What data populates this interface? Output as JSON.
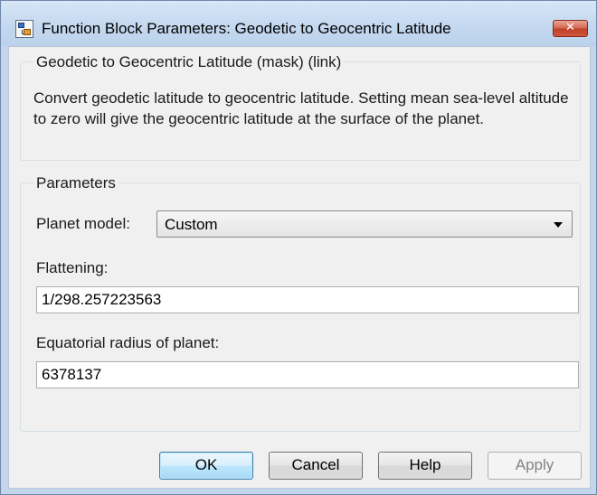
{
  "window": {
    "title": "Function Block Parameters: Geodetic to Geocentric Latitude",
    "close_label": "✕"
  },
  "description_group": {
    "legend": "Geodetic to Geocentric Latitude (mask) (link)",
    "text": "Convert geodetic latitude to geocentric latitude. Setting mean sea-level altitude to zero will give the geocentric latitude at the surface of the planet."
  },
  "parameters_group": {
    "legend": "Parameters",
    "planet_model": {
      "label": "Planet model:",
      "value": "Custom"
    },
    "flattening": {
      "label": "Flattening:",
      "value": "1/298.257223563"
    },
    "equatorial_radius": {
      "label": "Equatorial radius of planet:",
      "value": "6378137"
    }
  },
  "buttons": {
    "ok": "OK",
    "cancel": "Cancel",
    "help": "Help",
    "apply": "Apply",
    "apply_enabled": false
  },
  "colors": {
    "window_frame": "#c3d6ec",
    "client_background": "#f0f0f0",
    "close_button": "#c0412a",
    "default_button_border": "#3c7fb1"
  },
  "icons": {
    "app": "simulink-block-icon",
    "close": "close-icon",
    "dropdown": "chevron-down-icon"
  }
}
